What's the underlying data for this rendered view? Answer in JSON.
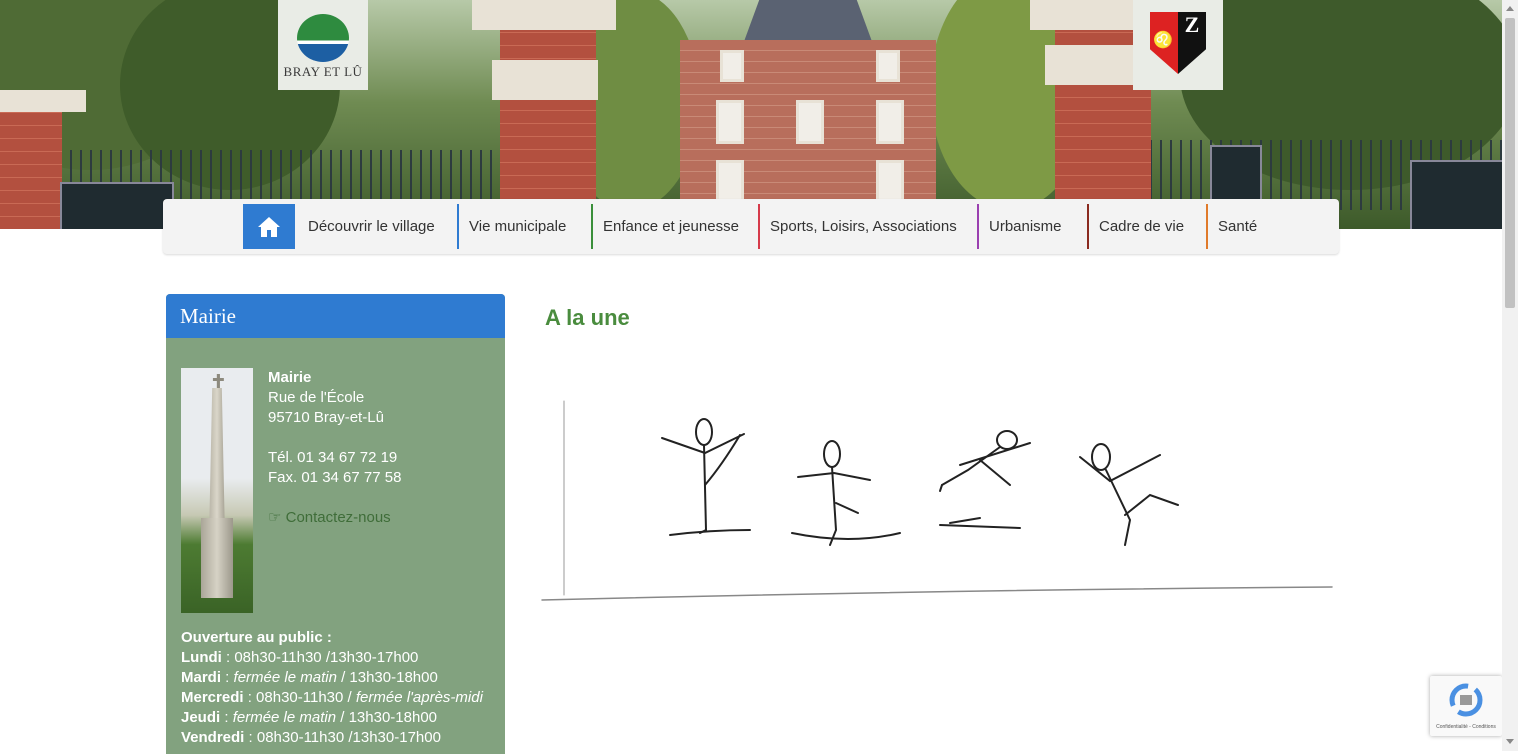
{
  "header": {
    "logo_text": "BRAY ET LÛ",
    "crest_letter": "Z"
  },
  "nav": {
    "home_icon": "home-icon",
    "items": [
      {
        "label": "Découvrir le village",
        "color": "#2f7bd1"
      },
      {
        "label": "Vie municipale",
        "color": "#2f7bd1"
      },
      {
        "label": "Enfance et jeunesse",
        "color": "#3a8f3a"
      },
      {
        "label": "Sports, Loisirs, Associations",
        "color": "#d63a4a"
      },
      {
        "label": "Urbanisme",
        "color": "#9a3fb0"
      },
      {
        "label": "Cadre de vie",
        "color": "#8a2a1f"
      },
      {
        "label": "Santé",
        "color": "#e07a2a"
      }
    ]
  },
  "sidebar": {
    "title": "Mairie",
    "address": {
      "name": "Mairie",
      "street": "Rue de l'École",
      "city": "95710 Bray-et-Lû",
      "tel": "Tél. 01 34 67 72 19",
      "fax": "Fax. 01 34 67 77 58",
      "contact_link": "Contactez-nous"
    },
    "hours": {
      "heading": "Ouverture au public :",
      "days": [
        {
          "day": "Lundi",
          "sep": " : ",
          "parts": [
            {
              "text": "08h30-11h30 /13h30-17h00",
              "italic": false
            }
          ]
        },
        {
          "day": "Mardi",
          "sep": " : ",
          "parts": [
            {
              "text": "fermée le matin",
              "italic": true
            },
            {
              "text": " / 13h30-18h00",
              "italic": false
            }
          ]
        },
        {
          "day": "Mercredi",
          "sep": " : ",
          "parts": [
            {
              "text": "08h30-11h30 / ",
              "italic": false
            },
            {
              "text": "fermée l'après-midi",
              "italic": true
            }
          ]
        },
        {
          "day": "Jeudi",
          "sep": " : ",
          "parts": [
            {
              "text": "fermée le matin",
              "italic": true
            },
            {
              "text": " / 13h30-18h00",
              "italic": false
            }
          ]
        },
        {
          "day": "Vendredi",
          "sep": " : ",
          "parts": [
            {
              "text": "08h30-11h30 /13h30-17h00",
              "italic": false
            }
          ]
        }
      ]
    }
  },
  "main": {
    "title": "A la une"
  },
  "recaptcha": {
    "text": "Confidentialité - Conditions"
  }
}
